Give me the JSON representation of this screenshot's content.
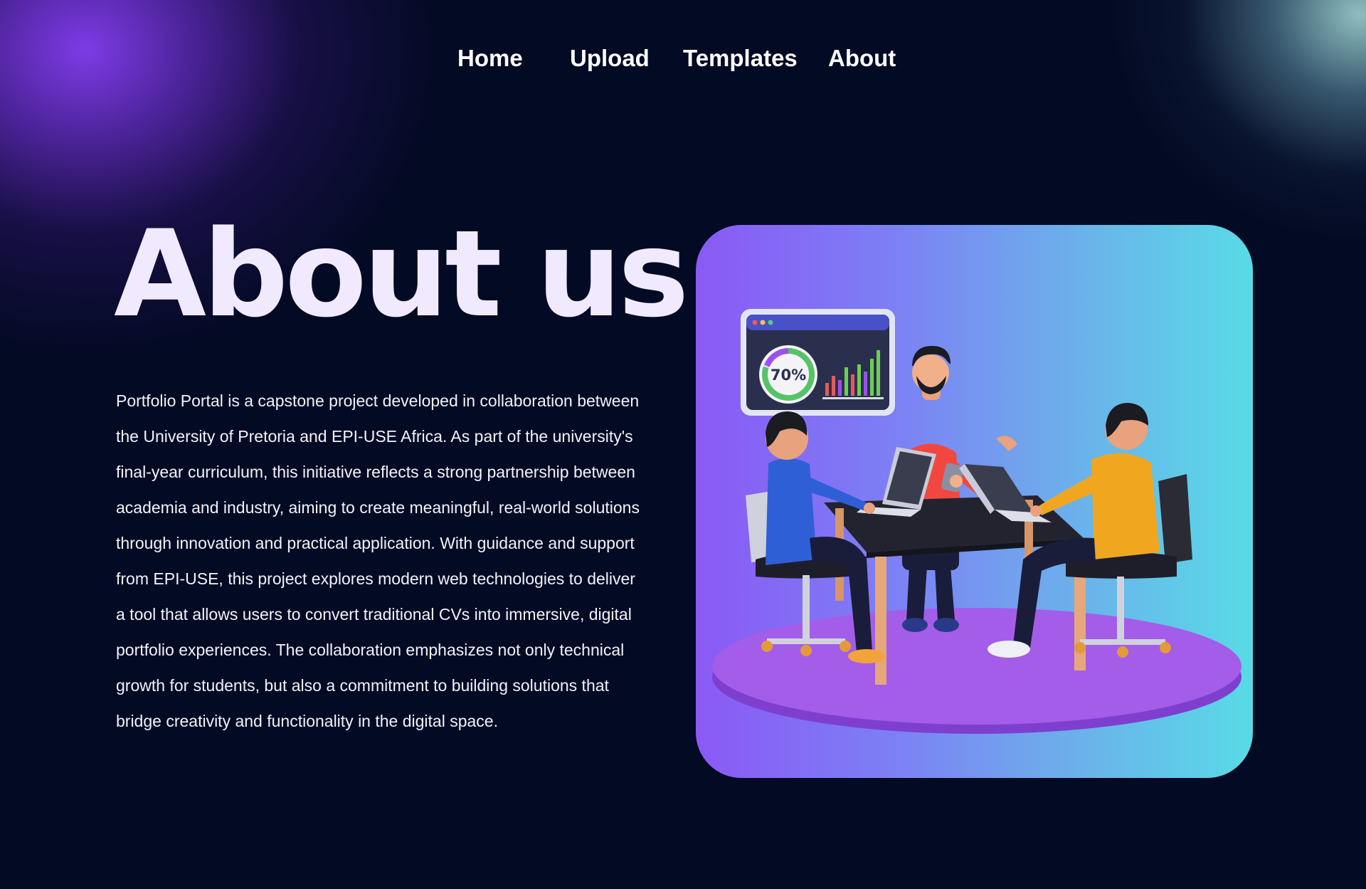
{
  "nav": {
    "items": [
      {
        "label": "Home"
      },
      {
        "label": "Upload"
      },
      {
        "label": "Templates"
      },
      {
        "label": "About"
      }
    ]
  },
  "hero": {
    "title": "About us",
    "paragraph": "Portfolio Portal is a capstone project developed in collaboration between the University of Pretoria and EPI-USE Africa. As part of the university's final-year curriculum, this initiative reflects a strong partnership between academia and industry, aiming to create meaningful, real-world solutions through innovation and practical application. With guidance and support from EPI-USE, this project explores modern web technologies to deliver a tool that allows users to convert traditional CVs into immersive, digital portfolio experiences. The collaboration emphasizes not only technical growth for students, but also a commitment to building solutions that bridge creativity and functionality in the digital space."
  },
  "illustration": {
    "dashboard_percent": "70%"
  },
  "colors": {
    "background": "#030a24",
    "glow_purple": "#843ef0",
    "glow_teal": "#96c8c8",
    "card_gradient_start": "#8a59f5",
    "card_gradient_end": "#58dbe6"
  }
}
